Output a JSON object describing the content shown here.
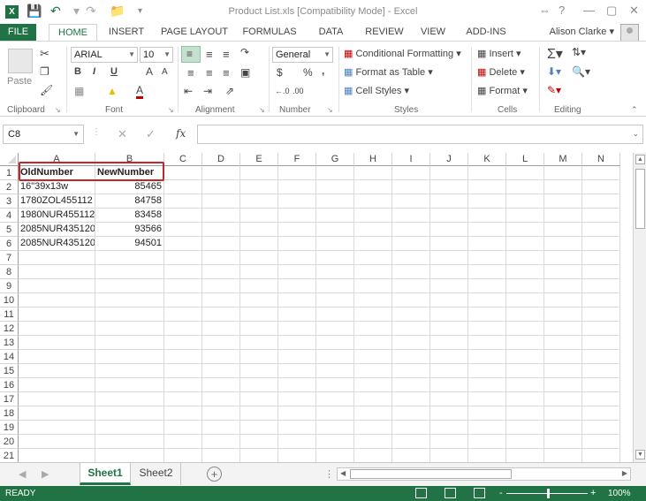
{
  "titlebar": {
    "logo": "X",
    "title": "Product List.xls  [Compatibility Mode] - Excel",
    "help": "?",
    "minimize": "—",
    "restore": "▢",
    "close": "✕"
  },
  "tabs": [
    "FILE",
    "HOME",
    "INSERT",
    "PAGE LAYOUT",
    "FORMULAS",
    "DATA",
    "REVIEW",
    "VIEW",
    "ADD-INS"
  ],
  "account": "Alison Clarke",
  "ribbon": {
    "clipboard": {
      "label": "Clipboard",
      "paste": "Paste"
    },
    "font": {
      "label": "Font",
      "name": "ARIAL",
      "size": "10",
      "bold": "B",
      "italic": "I",
      "underline": "U",
      "grow": "A",
      "shrink": "A",
      "font_color": "A"
    },
    "alignment": {
      "label": "Alignment"
    },
    "number": {
      "label": "Number",
      "format": "General",
      "currency": "$",
      "percent": "%",
      "comma": ","
    },
    "styles": {
      "label": "Styles",
      "conditional": "Conditional Formatting",
      "format_table": "Format as Table",
      "cell_styles": "Cell Styles"
    },
    "cells": {
      "label": "Cells",
      "insert": "Insert",
      "delete": "Delete",
      "format": "Format"
    },
    "editing": {
      "label": "Editing"
    }
  },
  "formula_bar": {
    "name_box": "C8",
    "fx": "fx",
    "value": ""
  },
  "grid": {
    "columns": [
      "A",
      "B",
      "C",
      "D",
      "E",
      "F",
      "G",
      "H",
      "I",
      "J",
      "K",
      "L",
      "M",
      "N"
    ],
    "rows": [
      "1",
      "2",
      "3",
      "4",
      "5",
      "6",
      "7",
      "8",
      "9",
      "10",
      "11",
      "12",
      "13",
      "14",
      "15",
      "16",
      "17",
      "18",
      "19",
      "20",
      "21"
    ],
    "cells": [
      {
        "a": "OldNumber",
        "b": "NewNumber"
      },
      {
        "a": "16\"39x13w",
        "b": "85465"
      },
      {
        "a": "1780ZOL455112",
        "b": "84758"
      },
      {
        "a": "1980NUR455112",
        "b": "83458"
      },
      {
        "a": "2085NUR435120",
        "b": "93566"
      },
      {
        "a": "2085NUR435120",
        "b": "94501"
      }
    ]
  },
  "sheets": {
    "tabs": [
      "Sheet1",
      "Sheet2"
    ],
    "active": "Sheet1",
    "add": "+"
  },
  "status": {
    "ready": "READY",
    "zoom": "100%",
    "zoom_minus": "-",
    "zoom_plus": "+"
  }
}
